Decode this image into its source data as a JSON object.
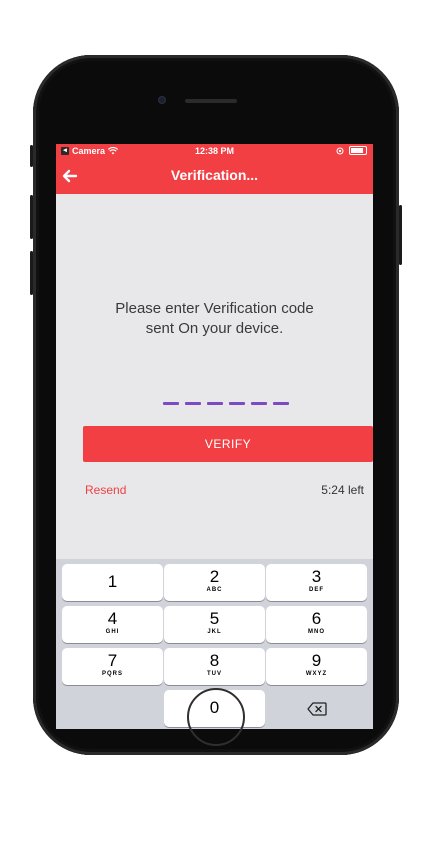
{
  "status_bar": {
    "back_app": "Camera",
    "time": "12:38 PM",
    "icons": [
      "wifi-icon",
      "location-icon",
      "battery-icon"
    ]
  },
  "nav": {
    "title": "Verification...",
    "back_icon": "back-arrow-icon"
  },
  "instruction": {
    "line1": "Please enter Verification code",
    "line2": "sent On your device."
  },
  "code": {
    "length": 6,
    "value": ""
  },
  "verify_button": {
    "label": "VERIFY"
  },
  "resend": {
    "label": "Resend"
  },
  "timer": {
    "text": "5:24 left"
  },
  "keypad": {
    "keys": [
      {
        "num": "1",
        "letters": ""
      },
      {
        "num": "2",
        "letters": "ABC"
      },
      {
        "num": "3",
        "letters": "DEF"
      },
      {
        "num": "4",
        "letters": "GHI"
      },
      {
        "num": "5",
        "letters": "JKL"
      },
      {
        "num": "6",
        "letters": "MNO"
      },
      {
        "num": "7",
        "letters": "PQRS"
      },
      {
        "num": "8",
        "letters": "TUV"
      },
      {
        "num": "9",
        "letters": "WXYZ"
      },
      {
        "num": "0",
        "letters": ""
      }
    ]
  },
  "colors": {
    "accent": "#f13f44",
    "code_dash": "#7a4bc2",
    "background": "#e8e8ea",
    "keypad": "#d0d3d9"
  }
}
